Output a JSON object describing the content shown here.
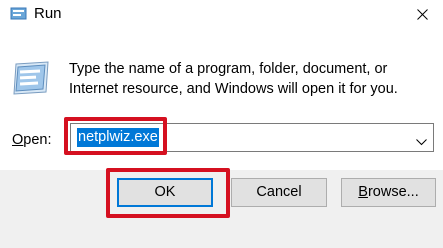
{
  "window": {
    "title": "Run",
    "title_icon": "run-icon",
    "close_icon": "close-icon"
  },
  "dialog": {
    "icon": "run-program-icon",
    "description_line1": "Type the name of a program, folder, document, or",
    "description_line2": "Internet resource, and Windows will open it for you."
  },
  "open_field": {
    "label_first": "O",
    "label_rest": "pen:",
    "value": "netplwiz.exe",
    "dropdown_icon": "chevron-down-icon"
  },
  "buttons": {
    "ok": "OK",
    "cancel": "Cancel",
    "browse_first": "B",
    "browse_rest": "rowse..."
  },
  "annotations": {
    "highlight_color": "#d51020",
    "highlighted": [
      "open-input",
      "ok-button"
    ]
  },
  "colors": {
    "selection": "#0078d7",
    "footer_background": "#f0f0f0",
    "button_background": "#e1e1e1"
  }
}
